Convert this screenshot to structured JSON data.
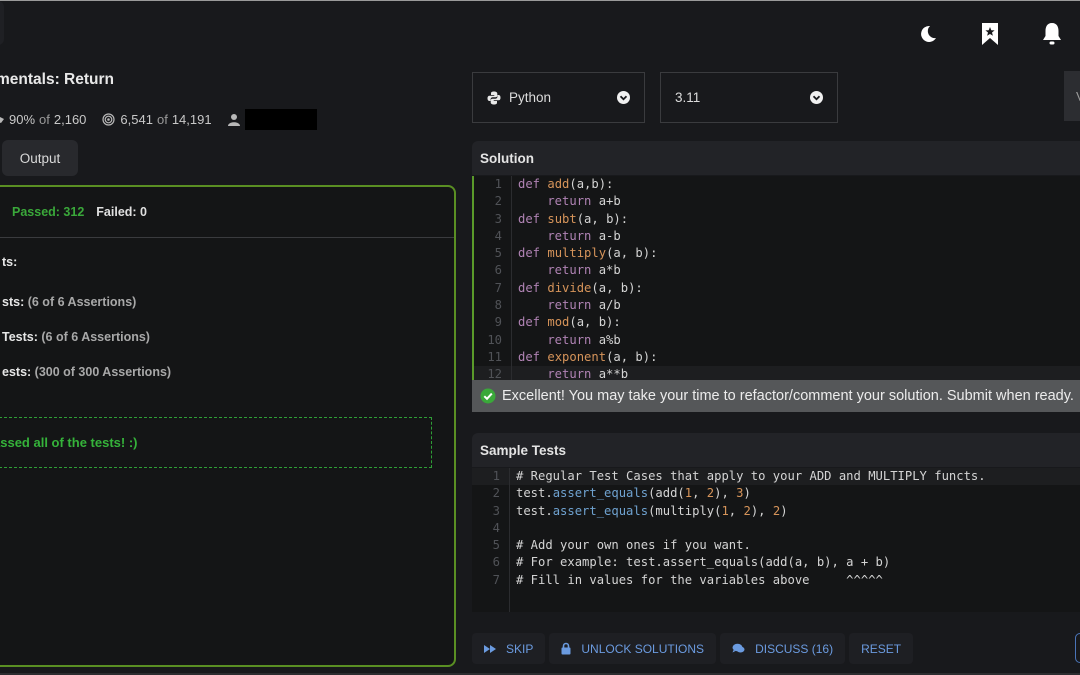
{
  "header": {
    "icons": [
      "moon-icon",
      "bookmark-star-icon",
      "bell-icon"
    ]
  },
  "kata": {
    "title": "mentals: Return",
    "satisfaction": "90%",
    "satisfaction_of": "of",
    "satisfaction_votes": "2,160",
    "completed": "6,541",
    "completed_of": "of",
    "completed_total": "14,191"
  },
  "tabs": {
    "output_label": "Output"
  },
  "output": {
    "passed": "Passed: 312",
    "failed": "Failed: 0",
    "groups": [
      {
        "label": "ts:",
        "detail": ""
      },
      {
        "label": "sts:",
        "detail": "(6 of 6 Assertions)"
      },
      {
        "label": "Tests:",
        "detail": "(6 of 6 Assertions)"
      },
      {
        "label": "ests:",
        "detail": "(300 of 300 Assertions)"
      }
    ],
    "success_message": "assed all of the tests! :)"
  },
  "language_select": {
    "value": "Python"
  },
  "version_select": {
    "value": "3.11"
  },
  "side_button": {
    "label": "V"
  },
  "solution": {
    "title": "Solution",
    "line_numbers": [
      "1",
      "2",
      "3",
      "4",
      "5",
      "6",
      "7",
      "8",
      "9",
      "10",
      "11",
      "12"
    ],
    "lines": [
      {
        "kw": "def ",
        "fn": "add",
        "rest": "(a,b):"
      },
      {
        "kw": "    return ",
        "fn": "",
        "rest": "a+b"
      },
      {
        "kw": "def ",
        "fn": "subt",
        "rest": "(a, b):"
      },
      {
        "kw": "    return ",
        "fn": "",
        "rest": "a-b"
      },
      {
        "kw": "def ",
        "fn": "multiply",
        "rest": "(a, b):"
      },
      {
        "kw": "    return ",
        "fn": "",
        "rest": "a*b"
      },
      {
        "kw": "def ",
        "fn": "divide",
        "rest": "(a, b):"
      },
      {
        "kw": "    return ",
        "fn": "",
        "rest": "a/b"
      },
      {
        "kw": "def ",
        "fn": "mod",
        "rest": "(a, b):"
      },
      {
        "kw": "    return ",
        "fn": "",
        "rest": "a%b"
      },
      {
        "kw": "def ",
        "fn": "exponent",
        "rest": "(a, b):"
      },
      {
        "kw": "    return ",
        "fn": "",
        "rest": "a**b"
      }
    ]
  },
  "notice": {
    "text": "Excellent! You may take your time to refactor/comment your solution. Submit when ready."
  },
  "sample_tests": {
    "title": "Sample Tests",
    "line_numbers": [
      "1",
      "2",
      "3",
      "4",
      "5",
      "6",
      "7"
    ],
    "line1": "# Regular Test Cases that apply to your ADD and MULTIPLY functs.",
    "line2": {
      "obj": "test.",
      "method": "assert_equals",
      "a": "(add(",
      "n1": "1",
      "c1": ", ",
      "n2": "2",
      "b": "), ",
      "n3": "3",
      "e": ")"
    },
    "line3": {
      "obj": "test.",
      "method": "assert_equals",
      "a": "(multiply(",
      "n1": "1",
      "c1": ", ",
      "n2": "2",
      "b": "), ",
      "n3": "2",
      "e": ")"
    },
    "line5": "# Add your own ones if you want.",
    "line6": "# For example: test.assert_equals(add(a, b), a + b)",
    "line7": "# Fill in values for the variables above     ^^^^^"
  },
  "actions": {
    "skip": "SKIP",
    "unlock": "UNLOCK SOLUTIONS",
    "discuss": "DISCUSS (16)",
    "reset": "RESET"
  },
  "colors": {
    "accent_green": "#5a8f23",
    "passed_green": "#3aa83a",
    "link_blue": "#6b9be0"
  }
}
